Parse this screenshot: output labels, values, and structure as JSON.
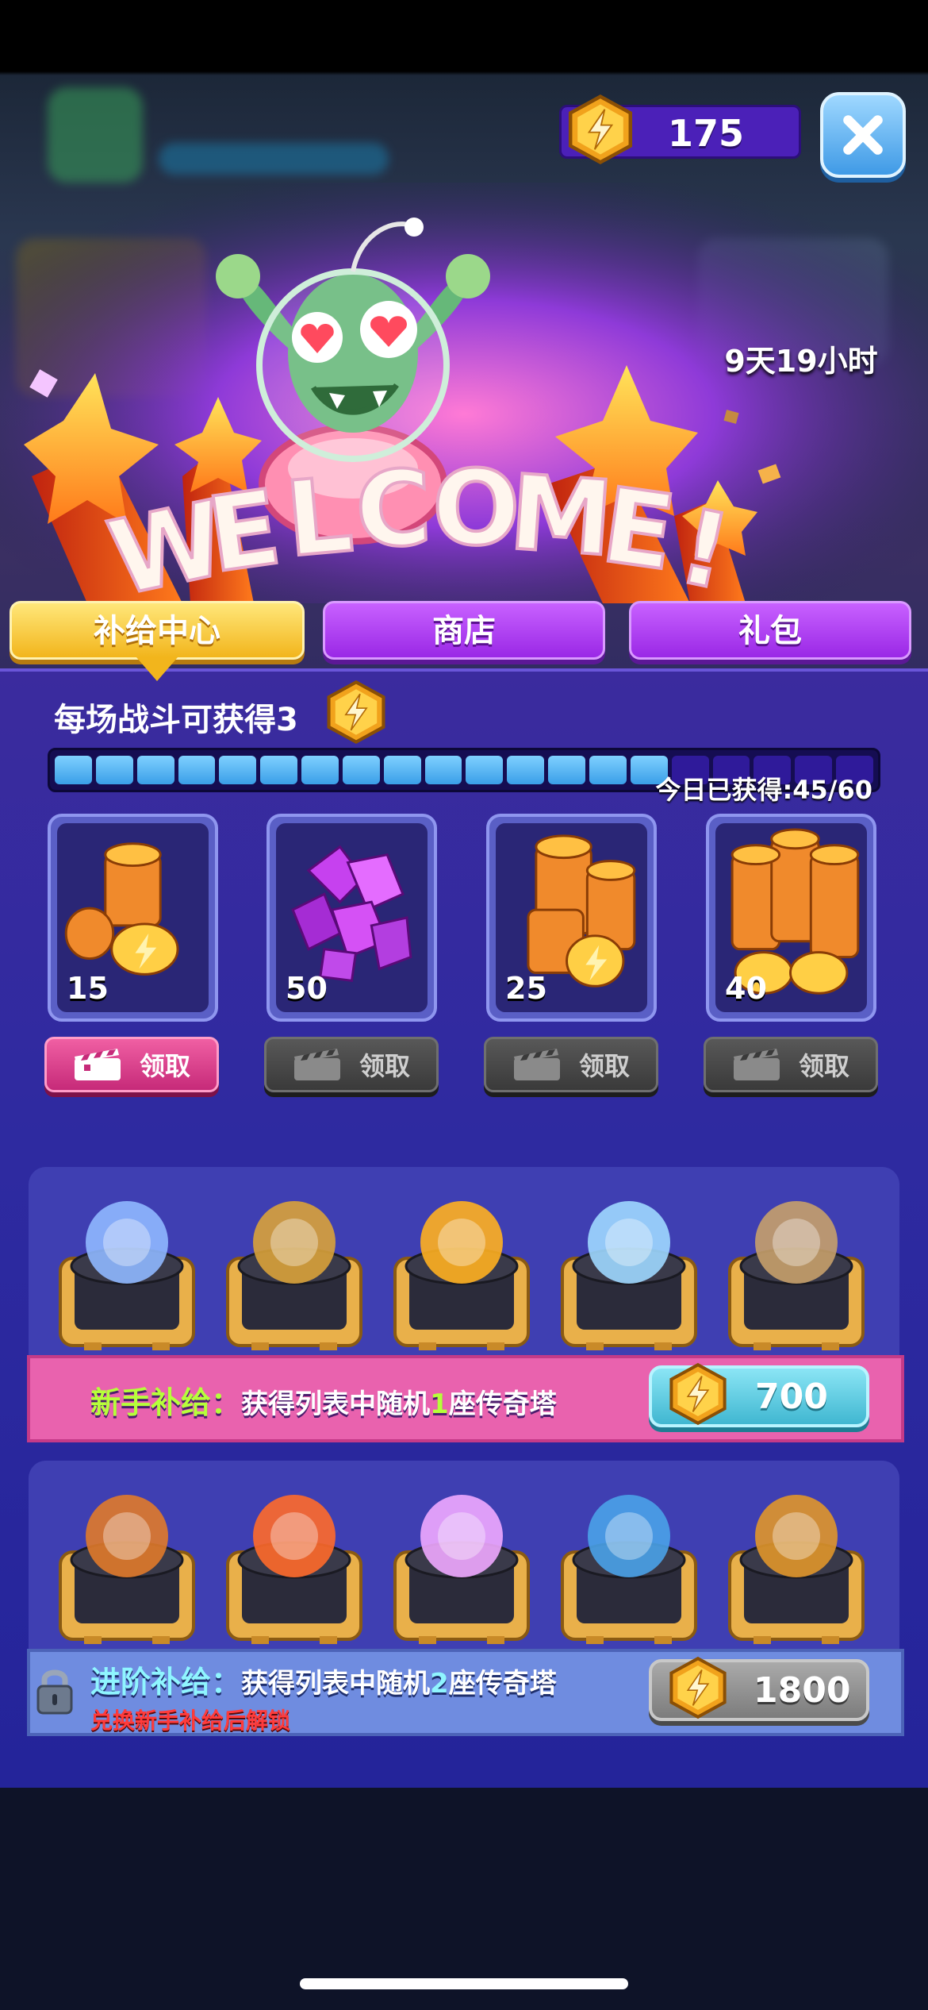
{
  "header": {
    "currency_value": "175",
    "currency_icon": "lightning-coin-icon",
    "close_icon": "close-icon"
  },
  "banner": {
    "headline": "WELCOME!",
    "countdown": "9天19小时",
    "mascot": "alien-mascot-illustration"
  },
  "tabs": [
    {
      "label": "补给中心",
      "active": true
    },
    {
      "label": "商店",
      "active": false
    },
    {
      "label": "礼包",
      "active": false
    }
  ],
  "battle": {
    "label": "每场战斗可获得3",
    "icon": "lightning-coin-icon",
    "progress_text": "今日已获得:45/60",
    "progress": 0.75,
    "segments_total": 20,
    "segments_filled": 15
  },
  "rewards": [
    {
      "amount": "15",
      "icon": "lightning-coins-icon",
      "claim_label": "领取",
      "claimable": true
    },
    {
      "amount": "50",
      "icon": "purple-gems-icon",
      "claim_label": "领取",
      "claimable": false
    },
    {
      "amount": "25",
      "icon": "lightning-coins-icon",
      "claim_label": "领取",
      "claimable": false
    },
    {
      "amount": "40",
      "icon": "lightning-coins-icon",
      "claim_label": "领取",
      "claimable": false
    }
  ],
  "starter_supply": {
    "title_prefix": "新手补给",
    "colon": "：",
    "desc_a": "获得列表中随机",
    "count": "1",
    "desc_b": "座传奇塔",
    "price": "700",
    "towers": [
      "orbit-tower-icon",
      "drum-tower-icon",
      "sun-tower-icon",
      "ice-gem-tower-icon",
      "flower-cannon-tower-icon"
    ]
  },
  "advanced_supply": {
    "title_prefix": "进阶补给",
    "colon": "：",
    "desc_a": "获得列表中随机",
    "count": "2",
    "desc_b": "座传奇塔",
    "unlock_note": "兑换新手补给后解锁",
    "price": "1800",
    "lock_icon": "lock-icon",
    "towers": [
      "telescope-tower-icon",
      "volcano-tower-icon",
      "cube-tower-icon",
      "fan-capsule-tower-icon",
      "rocket-launcher-tower-icon"
    ]
  },
  "colors": {
    "panel": "#2e2aa0",
    "tab_active": "#f2b51c",
    "tab_inactive": "#9a28e6",
    "claim_active": "#c62a79",
    "starter_strip": "#e962ae",
    "advanced_strip": "#6f8ce0",
    "highlight_text": "#b6ff3a",
    "warning_text": "#ff3b3b"
  }
}
